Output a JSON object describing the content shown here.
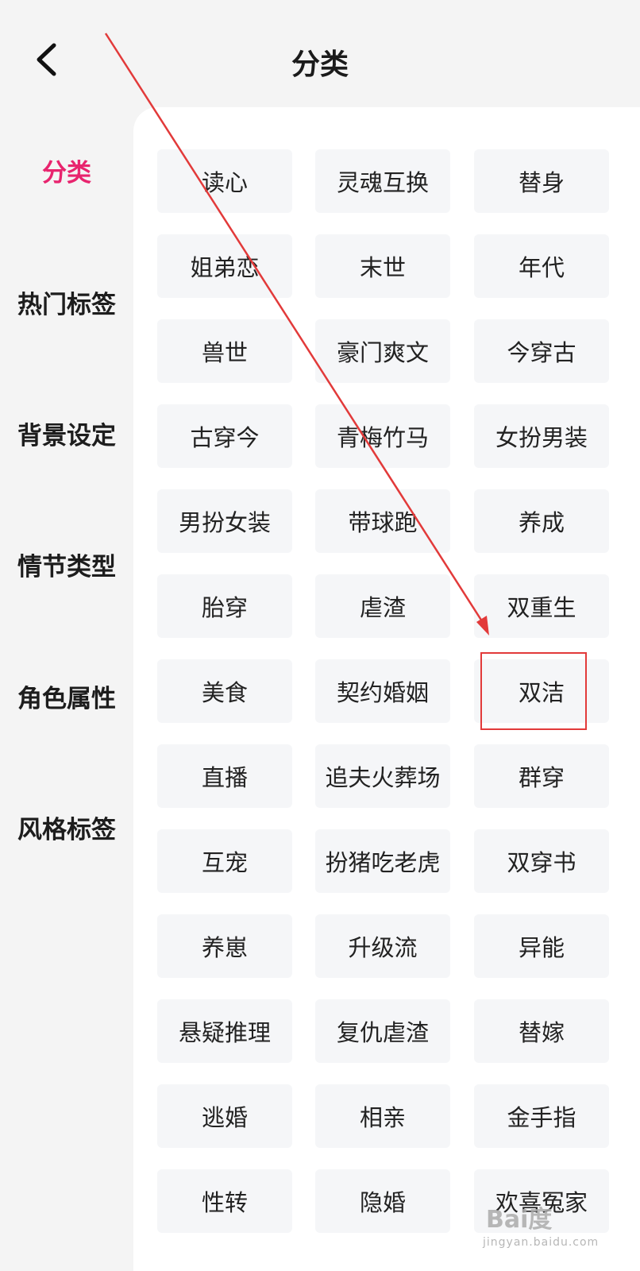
{
  "header": {
    "title": "分类"
  },
  "sidebar": {
    "items": [
      {
        "label": "分类",
        "active": true
      },
      {
        "label": "热门标签"
      },
      {
        "label": "背景设定"
      },
      {
        "label": "情节类型"
      },
      {
        "label": "角色属性"
      },
      {
        "label": "风格标签"
      }
    ]
  },
  "tags": [
    "读心",
    "灵魂互换",
    "替身",
    "姐弟恋",
    "末世",
    "年代",
    "兽世",
    "豪门爽文",
    "今穿古",
    "古穿今",
    "青梅竹马",
    "女扮男装",
    "男扮女装",
    "带球跑",
    "养成",
    "胎穿",
    "虐渣",
    "双重生",
    "美食",
    "契约婚姻",
    "双洁",
    "直播",
    "追夫火葬场",
    "群穿",
    "互宠",
    "扮猪吃老虎",
    "双穿书",
    "养崽",
    "升级流",
    "异能",
    "悬疑推理",
    "复仇虐渣",
    "替嫁",
    "逃婚",
    "相亲",
    "金手指",
    "性转",
    "隐婚",
    "欢喜冤家"
  ],
  "annotation": {
    "highlighted_tag": "双洁",
    "color": "#e23a3a"
  },
  "colors": {
    "accent": "#e8246e",
    "tag_bg": "#f5f6f8",
    "page_bg": "#f4f4f4"
  },
  "watermark": {
    "logo": "Bai度",
    "url": "jingyan.baidu.com"
  }
}
